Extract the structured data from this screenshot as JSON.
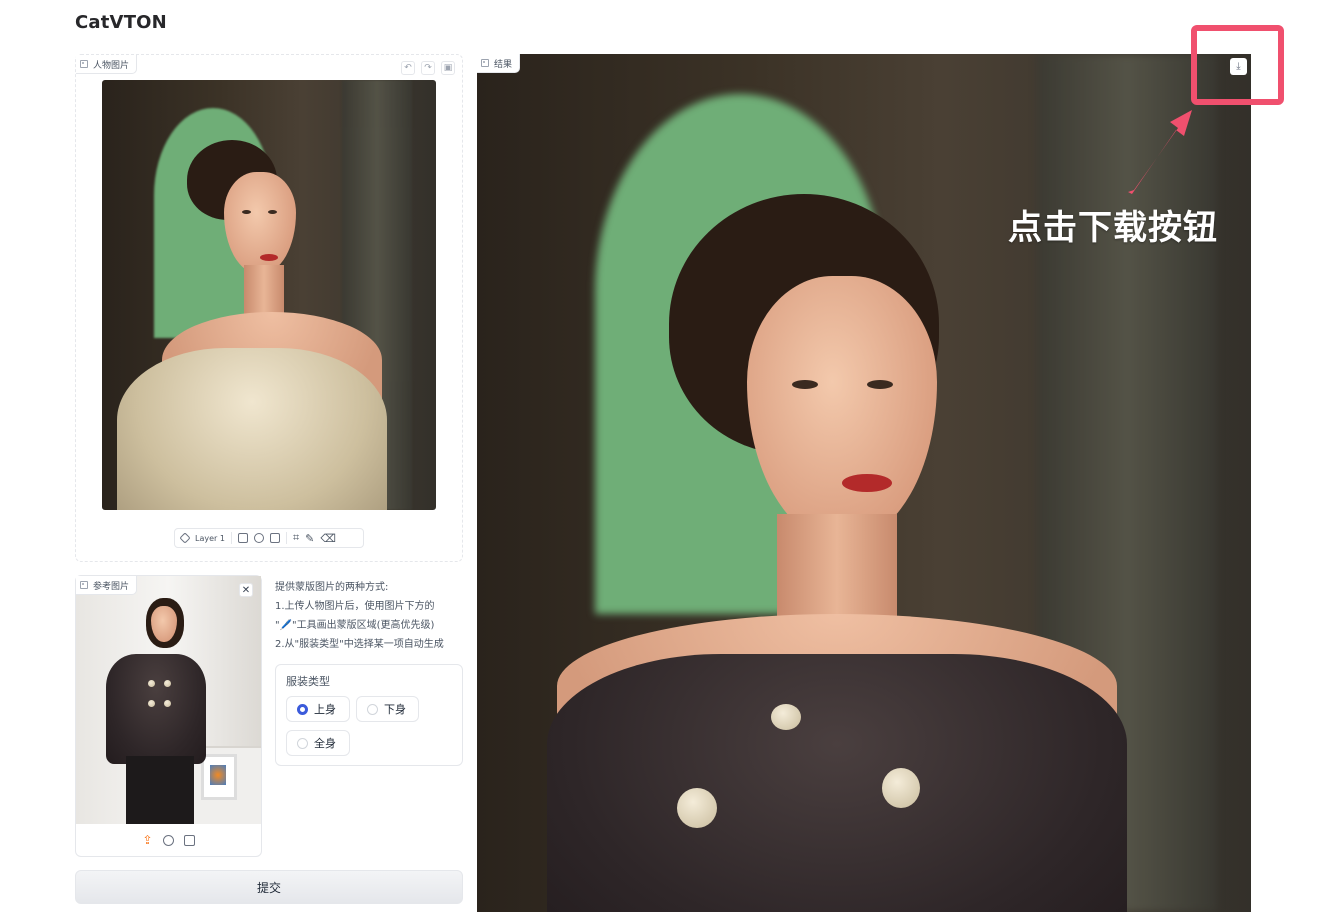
{
  "app": {
    "title": "CatVTON"
  },
  "person_block": {
    "label": "人物图片",
    "toolbar": {
      "layer_label": "Layer 1"
    }
  },
  "reference_block": {
    "label": "参考图片"
  },
  "instructions": {
    "lines": [
      "提供蒙版图片的两种方式:",
      "1.上传人物图片后，使用图片下方的",
      "\"🖊️\"工具画出蒙版区域(更高优先级)",
      "2.从\"服装类型\"中选择某一项自动生成"
    ]
  },
  "cloth_type": {
    "title": "服装类型",
    "options": [
      {
        "label": "上身",
        "selected": true
      },
      {
        "label": "下身",
        "selected": false
      },
      {
        "label": "全身",
        "selected": false
      }
    ]
  },
  "submit": {
    "label": "提交"
  },
  "result_block": {
    "label": "结果"
  },
  "annotation": {
    "text": "点击下载按钮"
  },
  "colors": {
    "accent": "#3b5bdb",
    "highlight": "#f0506e",
    "upload": "#f97316"
  }
}
